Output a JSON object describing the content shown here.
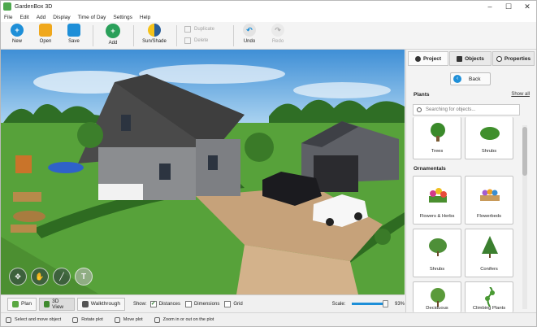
{
  "window": {
    "title": "GardenBox 3D"
  },
  "menu": [
    "File",
    "Edit",
    "Add",
    "Display",
    "Time of Day",
    "Settings",
    "Help"
  ],
  "toolbar": {
    "new_label": "New",
    "open_label": "Open",
    "save_label": "Save",
    "add_label": "Add",
    "sunshade_label": "Sun/Shade",
    "duplicate_label": "Duplicate",
    "delete_label": "Delete",
    "undo_label": "Undo",
    "redo_label": "Redo"
  },
  "view_tabs": {
    "plan": "Plan",
    "view3d": "3D View",
    "walkthrough": "Walkthrough"
  },
  "show": {
    "label": "Show:",
    "distances": "Distances",
    "dimensions": "Dimensions",
    "grid": "Grid",
    "distances_checked": true,
    "dimensions_checked": false,
    "grid_checked": false
  },
  "scale": {
    "label": "Scale:",
    "value": "93%",
    "fraction": 0.93
  },
  "status": {
    "select": "Select and move object",
    "rotate": "Rotate plot",
    "move": "Move plot",
    "zoom": "Zoom in or out on the plot"
  },
  "panel": {
    "tabs": [
      "Project",
      "Objects",
      "Properties"
    ],
    "back_label": "Back",
    "plants_heading": "Plants",
    "show_all": "Show all",
    "search_placeholder": "Searching for objects...",
    "top_items": [
      "Trees",
      "Shrubs"
    ],
    "ornamentals_heading": "Ornamentals",
    "ornamentals": [
      "Flowers & Herbs",
      "Flowerbeds",
      "Shrubs",
      "Conifers",
      "Deciduous",
      "Climbing Plants"
    ]
  },
  "colors": {
    "accent_blue": "#1e8fd8",
    "accent_green": "#2aa05a",
    "sky": "#5ea6df",
    "grass": "#4f9b34"
  }
}
